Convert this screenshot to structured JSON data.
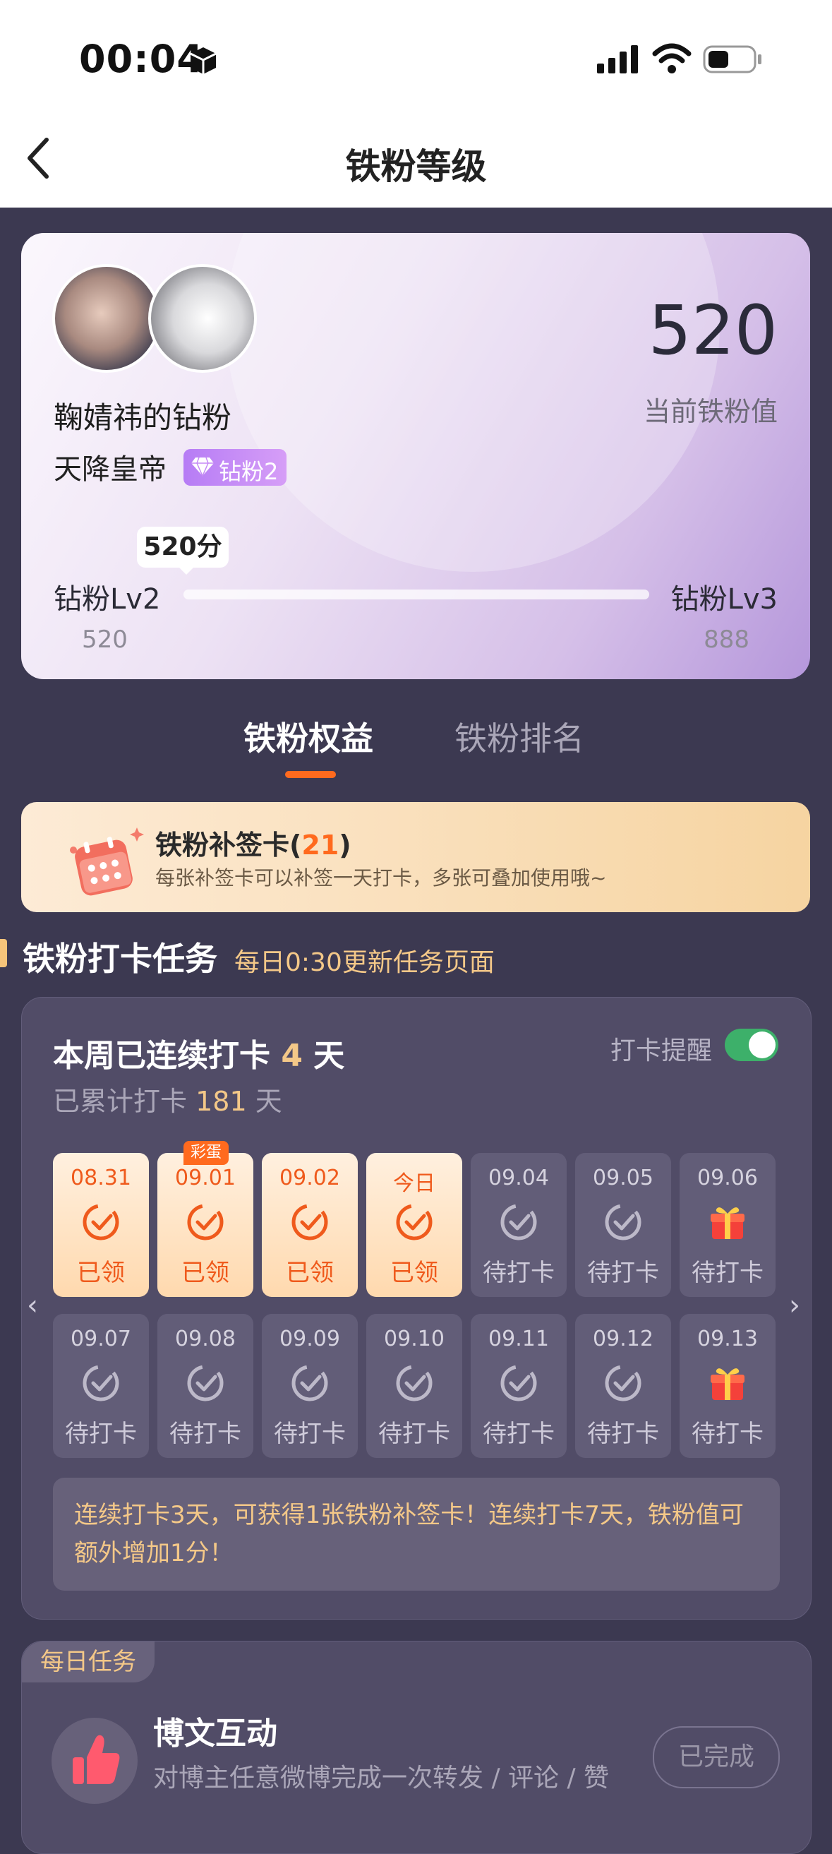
{
  "status": {
    "time": "00:04"
  },
  "nav": {
    "title": "铁粉等级"
  },
  "profile": {
    "creator_fans": "鞠婧祎的钻粉",
    "username": "天降皇帝",
    "badge": "钻粉2",
    "score": "520",
    "score_label": "当前铁粉值",
    "tooltip": "520分",
    "level_left": "钻粉Lv2",
    "level_right": "钻粉Lv3",
    "level_left_value": "520",
    "level_right_value": "888",
    "progress": 0
  },
  "tabs": {
    "active": "铁粉权益",
    "other": "铁粉排名"
  },
  "card_banner": {
    "title": "铁粉补签卡",
    "count": "21",
    "subtitle": "每张补签卡可以补签一天打卡，多张可叠加使用哦~"
  },
  "section": {
    "title": "铁粉打卡任务",
    "subtitle": "每日0:30更新任务页面"
  },
  "checkin": {
    "streak_prefix": "本周已连续打卡",
    "streak_days": "4",
    "streak_suffix": "天",
    "total_prefix": "已累计打卡",
    "total_days": "181",
    "total_suffix": "天",
    "reminder_label": "打卡提醒",
    "reminder_on": true,
    "egg_label": "彩蛋",
    "days": [
      {
        "date": "08.31",
        "status": "已领",
        "state": "done",
        "icon": "check-icon"
      },
      {
        "date": "09.01",
        "status": "已领",
        "state": "done",
        "icon": "check-icon"
      },
      {
        "date": "09.02",
        "status": "已领",
        "state": "done",
        "icon": "check-icon"
      },
      {
        "date": "今日",
        "status": "已领",
        "state": "done",
        "icon": "check-icon"
      },
      {
        "date": "09.04",
        "status": "待打卡",
        "state": "todo",
        "icon": "check-icon"
      },
      {
        "date": "09.05",
        "status": "待打卡",
        "state": "todo",
        "icon": "check-icon"
      },
      {
        "date": "09.06",
        "status": "待打卡",
        "state": "todo",
        "icon": "gift-icon"
      },
      {
        "date": "09.07",
        "status": "待打卡",
        "state": "todo",
        "icon": "check-icon"
      },
      {
        "date": "09.08",
        "status": "待打卡",
        "state": "todo",
        "icon": "check-icon"
      },
      {
        "date": "09.09",
        "status": "待打卡",
        "state": "todo",
        "icon": "check-icon"
      },
      {
        "date": "09.10",
        "status": "待打卡",
        "state": "todo",
        "icon": "check-icon"
      },
      {
        "date": "09.11",
        "status": "待打卡",
        "state": "todo",
        "icon": "check-icon"
      },
      {
        "date": "09.12",
        "status": "待打卡",
        "state": "todo",
        "icon": "check-icon"
      },
      {
        "date": "09.13",
        "status": "待打卡",
        "state": "todo",
        "icon": "gift-icon"
      }
    ],
    "note": "连续打卡3天，可获得1张铁粉补签卡！连续打卡7天，铁粉值可额外增加1分！"
  },
  "daily": {
    "label": "每日任务",
    "task_title": "博文互动",
    "task_desc": "对博主任意微博完成一次转发 / 评论 / 赞",
    "task_button": "已完成"
  },
  "colors": {
    "background": "#3c3951",
    "accent_orange": "#ff6a1e",
    "gold_text": "#f4c888",
    "toggle_green": "#3db06a"
  }
}
